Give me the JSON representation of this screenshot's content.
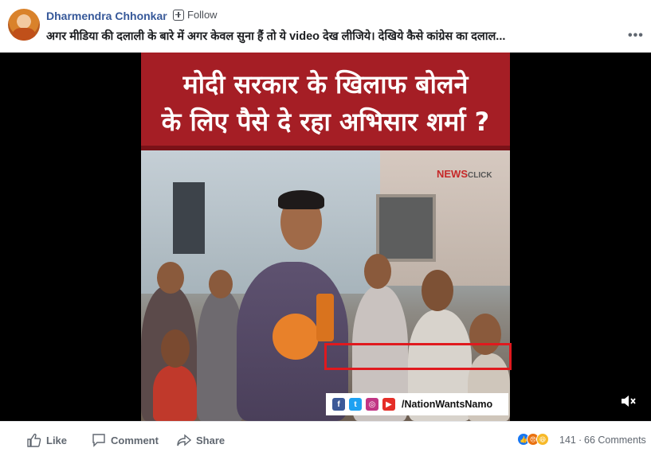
{
  "post": {
    "author": "Dharmendra Chhonkar",
    "separator": "·",
    "follow_label": "Follow",
    "caption": "अगर मीडिया की दलाली के बारे में अगर केवल सुना हैं तो ये video देख लीजिये। देखिये कैसे कांग्रेस का दलाल...",
    "more_label": "•••"
  },
  "video": {
    "title_line1": "मोदी सरकार के खिलाफ बोलने",
    "title_line2": "के लिए पैसे दे रहा अभिसार शर्मा ?",
    "channel_logo": "NEWS",
    "channel_logo_small": "CLICK",
    "social_icons": [
      "facebook-icon",
      "twitter-icon",
      "instagram-icon",
      "youtube-icon"
    ],
    "social_handle": "/NationWantsNamo",
    "highlight_color": "#e0191e",
    "title_band_color": "#a51e25"
  },
  "footer": {
    "like_label": "Like",
    "comment_label": "Comment",
    "share_label": "Share",
    "reactions": [
      "like-icon",
      "angry-icon",
      "haha-icon"
    ],
    "reaction_count": "141",
    "dot": "·",
    "comments_count": "66 Comments"
  }
}
